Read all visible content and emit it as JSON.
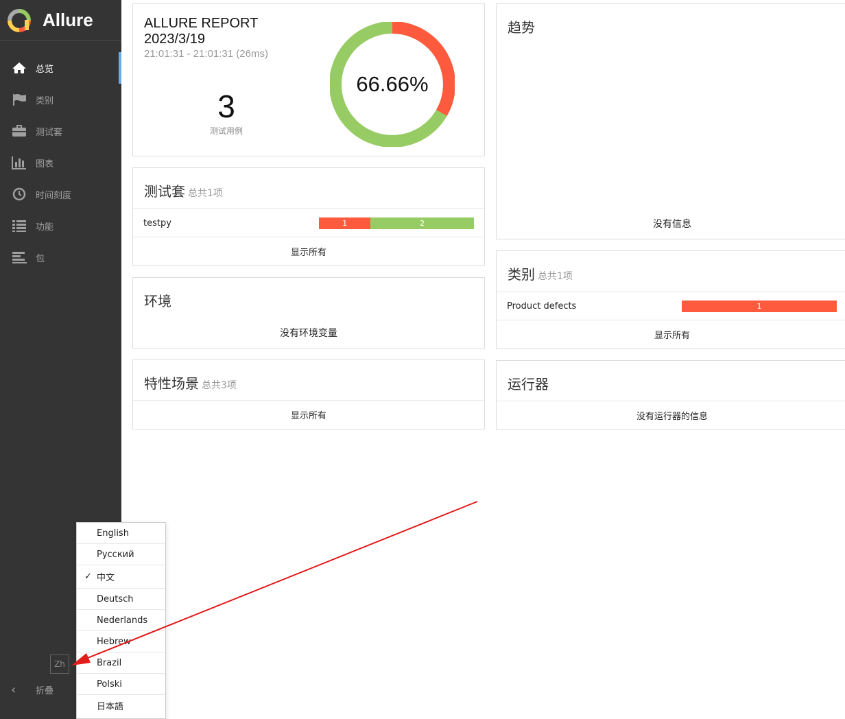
{
  "brand": {
    "title": "Allure"
  },
  "nav": {
    "items": [
      {
        "label": "总览",
        "icon": "home-icon",
        "active": true
      },
      {
        "label": "类别",
        "icon": "flag-icon"
      },
      {
        "label": "测试套",
        "icon": "briefcase-icon"
      },
      {
        "label": "图表",
        "icon": "bar-chart-icon"
      },
      {
        "label": "时间刻度",
        "icon": "clock-icon"
      },
      {
        "label": "功能",
        "icon": "list-icon"
      },
      {
        "label": "包",
        "icon": "align-left-icon"
      }
    ],
    "lang_chip": "Zh",
    "collapse": "折叠"
  },
  "language_menu": {
    "options": [
      "English",
      "Русский",
      "中文",
      "Deutsch",
      "Nederlands",
      "Hebrew",
      "Brazil",
      "Polski",
      "日本語"
    ],
    "selected": "中文"
  },
  "summary": {
    "title_line1": "ALLURE REPORT",
    "title_line2": "2023/3/19",
    "time": "21:01:31 - 21:01:31 (26ms)",
    "test_count": "3",
    "test_count_label": "测试用例",
    "percent": "66.66%",
    "passed": 2,
    "failed": 1
  },
  "suites": {
    "title": "测试套",
    "subtitle": "总共1项",
    "rows": [
      {
        "name": "testpy",
        "failed": 1,
        "passed": 2
      }
    ],
    "footer": "显示所有"
  },
  "environment": {
    "title": "环境",
    "empty": "没有环境变量"
  },
  "features": {
    "title": "特性场景",
    "subtitle": "总共3项",
    "footer": "显示所有"
  },
  "trend": {
    "title": "趋势",
    "empty": "没有信息"
  },
  "categories": {
    "title": "类别",
    "subtitle": "总共1项",
    "rows": [
      {
        "name": "Product defects",
        "count": 1
      }
    ],
    "footer": "显示所有"
  },
  "executors": {
    "title": "运行器",
    "empty": "没有运行器的信息"
  },
  "colors": {
    "failed": "#fd5a3e",
    "passed": "#97cc64",
    "sidebar": "#343434",
    "accent": "#6cace4",
    "annotation_arrow": "#e21b1b"
  }
}
